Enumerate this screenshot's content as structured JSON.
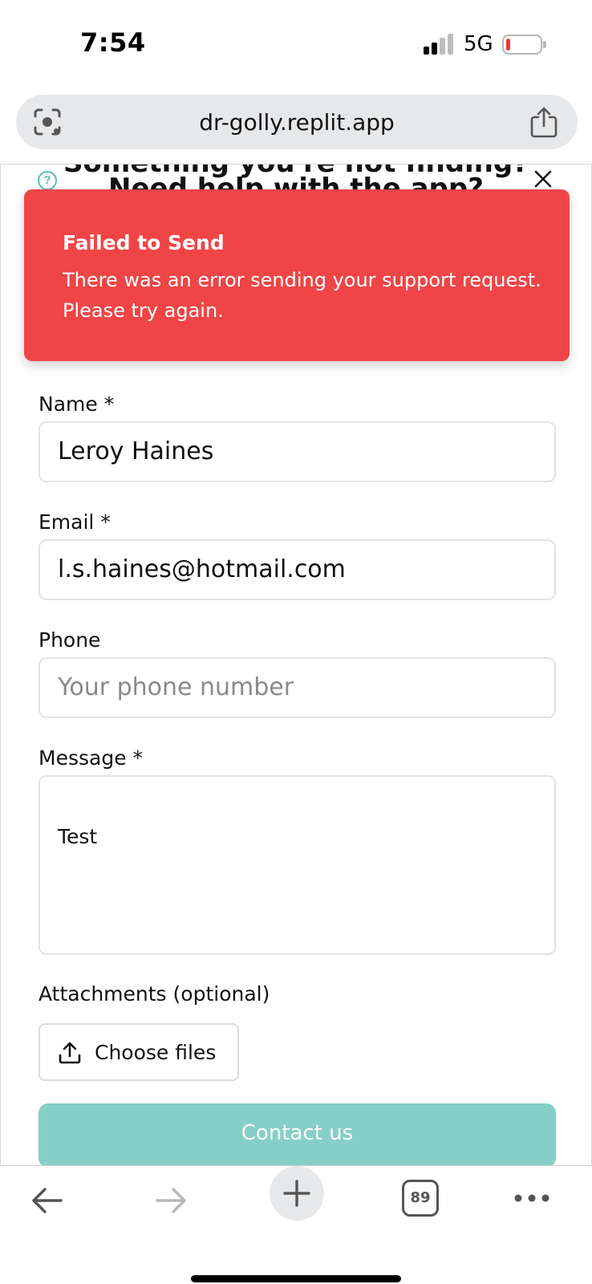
{
  "status_bar": {
    "time": "7:54",
    "network": "5G",
    "battery_level": 0.12
  },
  "browser": {
    "url": "dr-golly.replit.app",
    "tab_count": "89"
  },
  "dialog": {
    "heading_line1": "Something you're not finding?",
    "heading_line2": "Need help with the app?",
    "help_icon": "?"
  },
  "toast": {
    "title": "Failed to Send",
    "message": "There was an error sending your support request. Please try again.",
    "color": "#ef4546"
  },
  "form": {
    "name_label": "Name *",
    "name_value": "Leroy  Haines",
    "email_label": "Email *",
    "email_value": "l.s.haines@hotmail.com",
    "phone_label": "Phone",
    "phone_placeholder": "Your phone number",
    "message_label": "Message *",
    "message_value": "Test",
    "attachments_label": "Attachments (optional)",
    "choose_files_label": "Choose files",
    "submit_label": "Contact us",
    "accent_color": "#86cfc8"
  },
  "icons": {
    "lens": "camera-lens-icon",
    "share": "share-icon",
    "close": "close-icon",
    "upload": "upload-icon",
    "back": "arrow-left-icon",
    "forward": "arrow-right-icon",
    "new_tab": "plus-icon",
    "more": "ellipsis-icon"
  }
}
